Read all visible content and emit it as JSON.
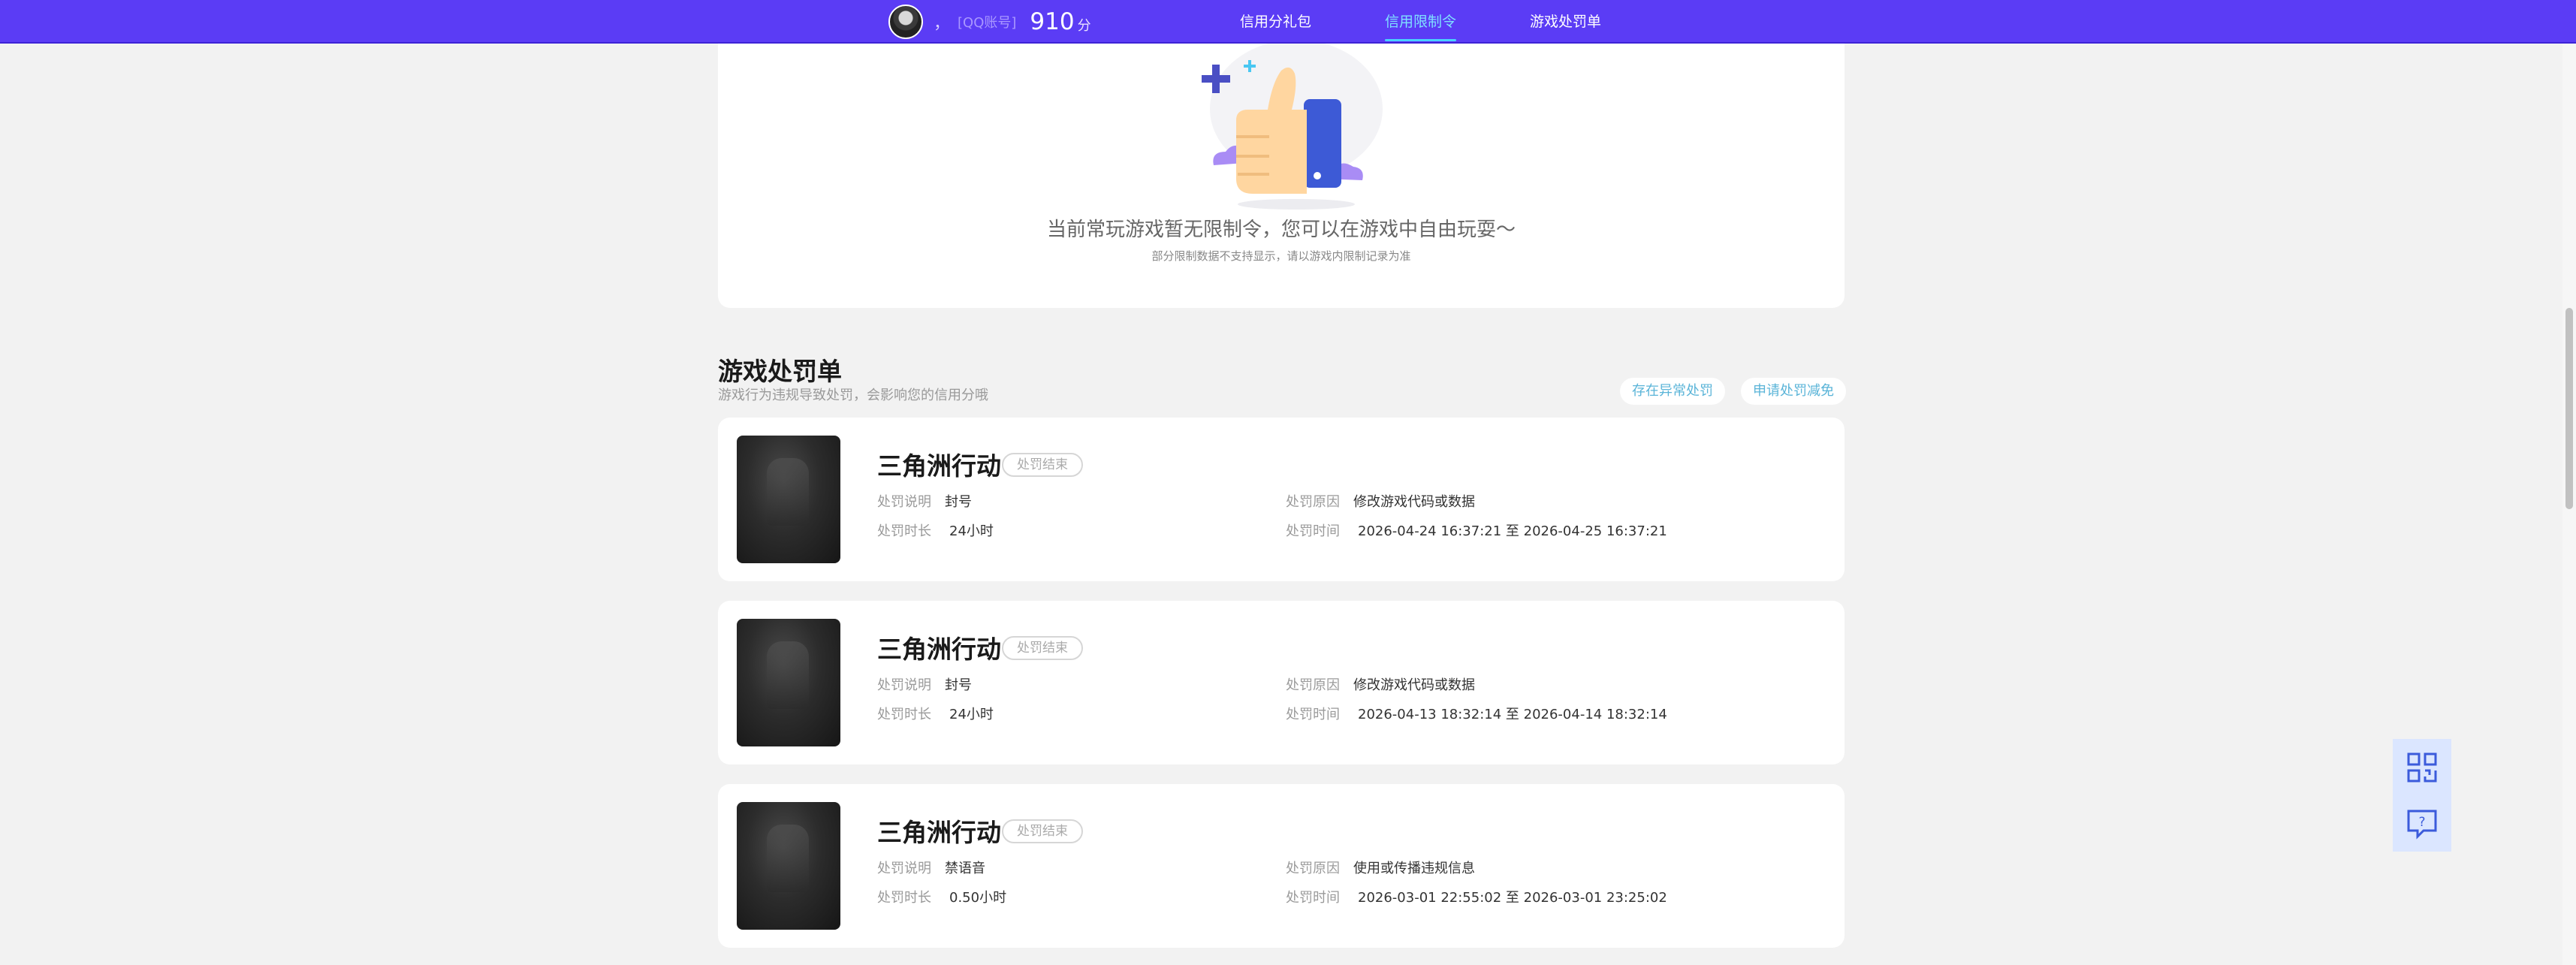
{
  "topbar": {
    "separator": "，",
    "account_label": "[QQ账号]",
    "score": "910",
    "score_unit": "分",
    "nav": [
      {
        "label": "信用分礼包"
      },
      {
        "label": "信用限制令"
      },
      {
        "label": "游戏处罚单"
      }
    ],
    "active_nav": "信用限制令"
  },
  "hero": {
    "message": "当前常玩游戏暂无限制令，您可以在游戏中自由玩耍～",
    "sub_message": "部分限制数据不支持显示，请以游戏内限制记录为准"
  },
  "penalty_section": {
    "title": "游戏处罚单",
    "description": "游戏行为违规导致处罚，会影响您的信用分哦",
    "buttons": [
      {
        "label": "存在异常处罚"
      },
      {
        "label": "申请处罚减免"
      }
    ],
    "field_labels": {
      "desc": "处罚说明",
      "duration": "处罚时长",
      "reason": "处罚原因",
      "time": "处罚时间"
    },
    "items": [
      {
        "game": "三角洲行动",
        "status": "处罚结束",
        "desc": "封号",
        "duration": "24小时",
        "reason": "修改游戏代码或数据",
        "time": "2026-04-24 16:37:21 至 2026-04-25 16:37:21"
      },
      {
        "game": "三角洲行动",
        "status": "处罚结束",
        "desc": "封号",
        "duration": "24小时",
        "reason": "修改游戏代码或数据",
        "time": "2026-04-13 18:32:14 至 2026-04-14 18:32:14"
      },
      {
        "game": "三角洲行动",
        "status": "处罚结束",
        "desc": "禁语音",
        "duration": "0.50小时",
        "reason": "使用或传播违规信息",
        "time": "2026-03-01 22:55:02 至 2026-03-01 23:25:02"
      }
    ]
  },
  "floating": {
    "icons": [
      "qr-code-icon",
      "help-feedback-icon"
    ]
  },
  "colors": {
    "topbar": "#5b3cf5",
    "active_nav": "#7fe0ff",
    "pill_text": "#5ab4d8",
    "float_bg": "#dbe6ff"
  }
}
